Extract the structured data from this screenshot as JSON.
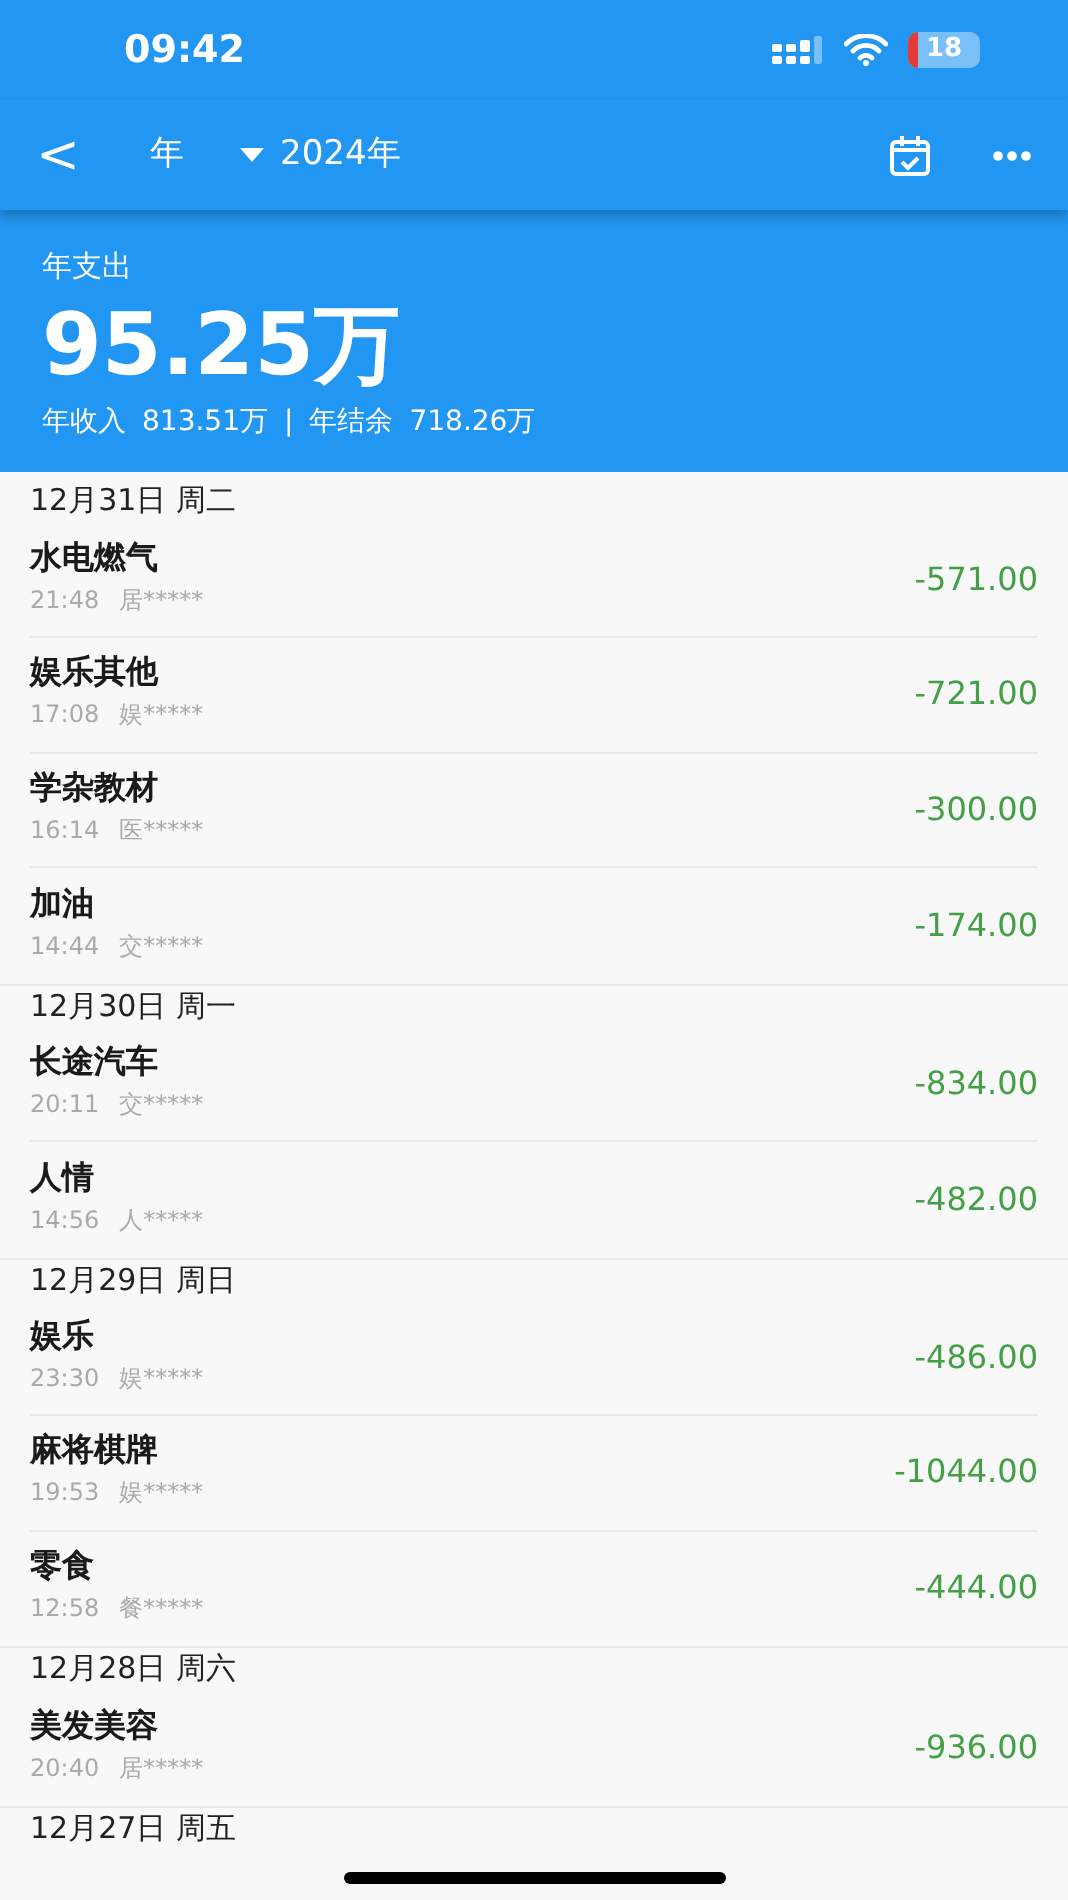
{
  "status_bar": {
    "time": "09:42",
    "battery": "18"
  },
  "toolbar": {
    "back": "<",
    "period": "年",
    "year": "2024年"
  },
  "summary": {
    "label": "年支出",
    "total": "95.25万",
    "income_label": "年收入",
    "income": "813.51万",
    "separator": "|",
    "balance_label": "年结余",
    "balance": "718.26万"
  },
  "groups": [
    {
      "date": "12月31日 周二",
      "items": [
        {
          "title": "水电燃气",
          "time": "21:48",
          "note": "居*****",
          "amount": "-571.00"
        },
        {
          "title": "娱乐其他",
          "time": "17:08",
          "note": "娱*****",
          "amount": "-721.00"
        },
        {
          "title": "学杂教材",
          "time": "16:14",
          "note": "医*****",
          "amount": "-300.00"
        },
        {
          "title": "加油",
          "time": "14:44",
          "note": "交*****",
          "amount": "-174.00"
        }
      ]
    },
    {
      "date": "12月30日 周一",
      "items": [
        {
          "title": "长途汽车",
          "time": "20:11",
          "note": "交*****",
          "amount": "-834.00"
        },
        {
          "title": "人情",
          "time": "14:56",
          "note": "人*****",
          "amount": "-482.00"
        }
      ]
    },
    {
      "date": "12月29日 周日",
      "items": [
        {
          "title": "娱乐",
          "time": "23:30",
          "note": "娱*****",
          "amount": "-486.00"
        },
        {
          "title": "麻将棋牌",
          "time": "19:53",
          "note": "娱*****",
          "amount": "-1044.00"
        },
        {
          "title": "零食",
          "time": "12:58",
          "note": "餐*****",
          "amount": "-444.00"
        }
      ]
    },
    {
      "date": "12月28日 周六",
      "items": [
        {
          "title": "美发美容",
          "time": "20:40",
          "note": "居*****",
          "amount": "-936.00"
        }
      ]
    },
    {
      "date": "12月27日 周五"
    }
  ]
}
